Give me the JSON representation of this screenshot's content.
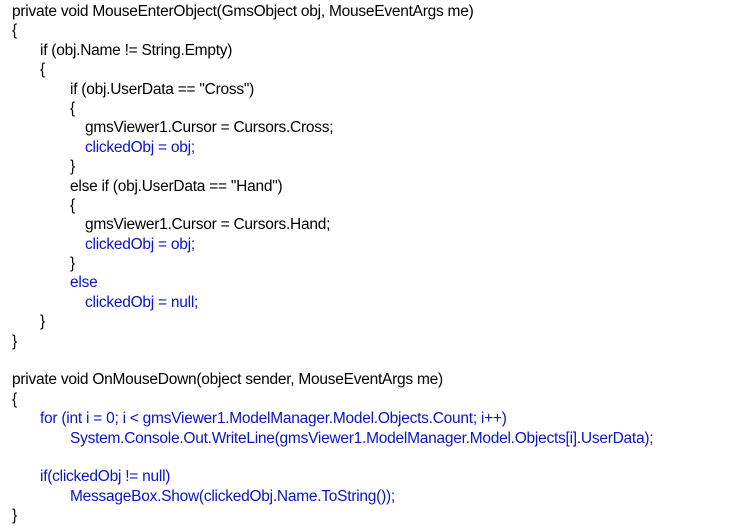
{
  "colors": {
    "text": "#000000",
    "highlight": "#0a14c8",
    "background": "#ffffff"
  },
  "code": {
    "lines": [
      "private void MouseEnterObject(GmsObject obj, MouseEventArgs me)",
      "{",
      "if (obj.Name != String.Empty)",
      "{",
      "if (obj.UserData == \"Cross\")",
      "{",
      "gmsViewer1.Cursor = Cursors.Cross;",
      "clickedObj = obj;",
      "}",
      "else if (obj.UserData == \"Hand\")",
      "{",
      "gmsViewer1.Cursor = Cursors.Hand;",
      "clickedObj = obj;",
      "}",
      "else",
      "clickedObj = null;",
      "}",
      "}",
      "",
      "private void OnMouseDown(object sender, MouseEventArgs me)",
      "{",
      "for (int i = 0; i < gmsViewer1.ModelManager.Model.Objects.Count; i++)",
      "System.Console.Out.WriteLine(gmsViewer1.ModelManager.Model.Objects[i].UserData);",
      "",
      "if(clickedObj != null)",
      "MessageBox.Show(clickedObj.Name.ToString());",
      "}"
    ]
  }
}
